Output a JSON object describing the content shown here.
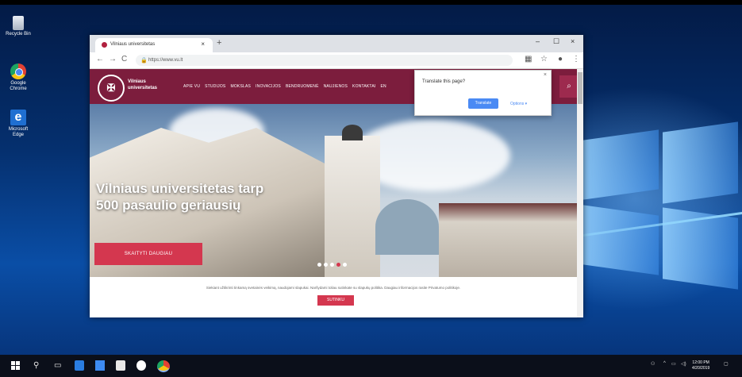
{
  "desktop": {
    "icons": [
      {
        "label": "Recycle Bin"
      },
      {
        "label": "Google Chrome"
      },
      {
        "label": "Microsoft Edge"
      }
    ]
  },
  "browser": {
    "tab_title": "Vilniaus universitetas",
    "tab_close": "×",
    "new_tab": "+",
    "window_controls": {
      "minimize": "–",
      "maximize": "☐",
      "close": "×"
    },
    "url": "https://www.vu.lt",
    "nav": {
      "back": "←",
      "forward": "→",
      "reload": "C"
    }
  },
  "site": {
    "brand_line1": "Vilniaus",
    "brand_line2": "universitetas",
    "menu": [
      "APIE VU",
      "STUDIJOS",
      "MOKSLAS",
      "INOVACIJOS",
      "BENDRUOMENĖ",
      "NAUJIENOS",
      "KONTAKTAI",
      "EN"
    ],
    "headline_line1": "Vilniaus universitetas tarp",
    "headline_line2": "500 pasaulio geriausių",
    "cta_label": "SKAITYTI DAUGIAU",
    "cookie_text": "Siekiant užtikrinti tinkamą svetainės veikimą, naudojami slapukai. Naršydami toliau sutinkate su slapukų politika. Daugiau informacijos rasite Privatumo politikoje.",
    "cookie_button": "SUTINKU"
  },
  "translate_popup": {
    "question": "Translate this page?",
    "translate_button": "Translate",
    "options_link": "Options ▾",
    "close": "×"
  },
  "taskbar": {
    "time": "12:00 PM",
    "date": "4/20/2019"
  }
}
